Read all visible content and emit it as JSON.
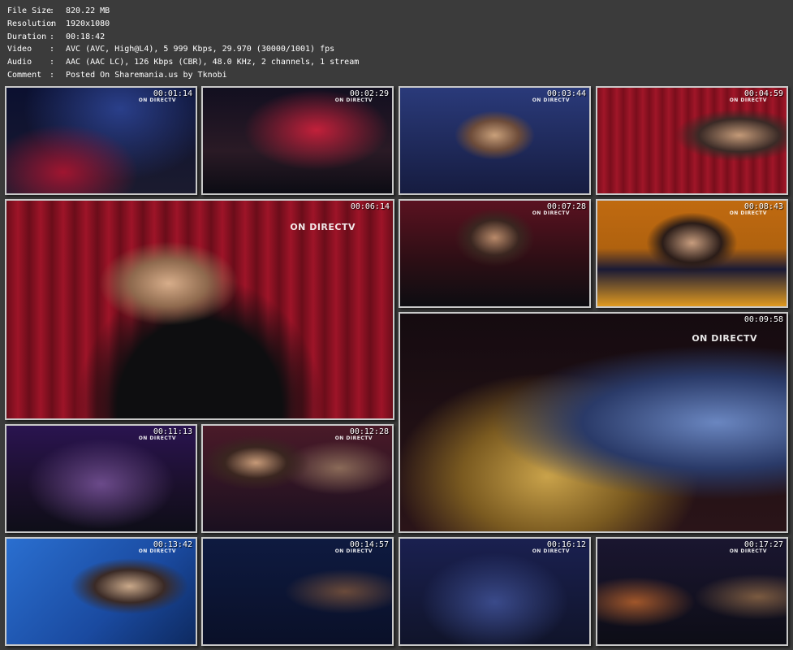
{
  "info": {
    "rows": [
      {
        "label": "File Size",
        "value": "820.22 MB"
      },
      {
        "label": "Resolution",
        "value": "1920x1080"
      },
      {
        "label": "Duration",
        "value": "00:18:42"
      },
      {
        "label": "Video",
        "value": "AVC (AVC, High@L4), 5 999 Kbps, 29.970 (30000/1001) fps"
      },
      {
        "label": "Audio",
        "value": "AAC (AAC LC), 126 Kbps (CBR), 48.0 KHz, 2 channels, 1 stream"
      },
      {
        "label": "Comment",
        "value": "Posted On Sharemania.us by Tknobi"
      }
    ]
  },
  "watermark": "ON DIRECTV",
  "thumbnails": [
    {
      "timestamp": "00:01:14"
    },
    {
      "timestamp": "00:02:29"
    },
    {
      "timestamp": "00:03:44"
    },
    {
      "timestamp": "00:04:59"
    },
    {
      "timestamp": "00:06:14"
    },
    {
      "timestamp": "00:07:28"
    },
    {
      "timestamp": "00:08:43"
    },
    {
      "timestamp": "00:09:58"
    },
    {
      "timestamp": "00:11:13"
    },
    {
      "timestamp": "00:12:28"
    },
    {
      "timestamp": "00:13:42"
    },
    {
      "timestamp": "00:14:57"
    },
    {
      "timestamp": "00:16:12"
    },
    {
      "timestamp": "00:17:27"
    }
  ]
}
